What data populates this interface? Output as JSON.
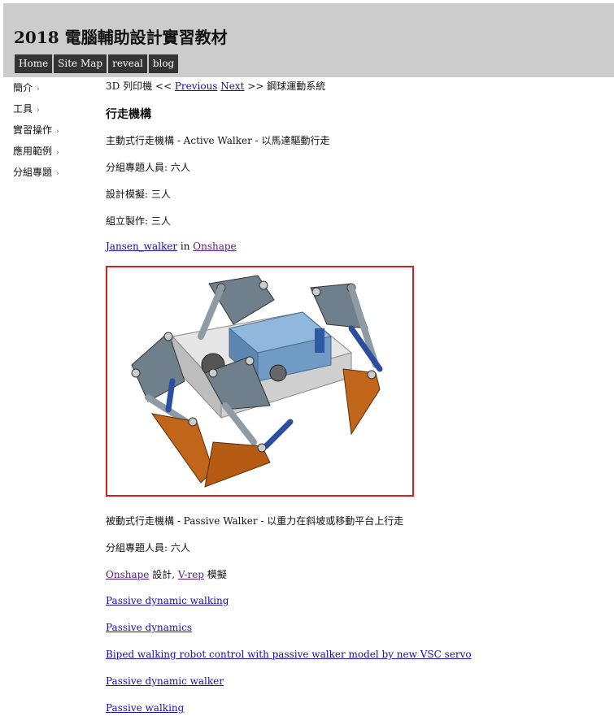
{
  "site": {
    "title": "2018 電腦輔助設計實習教材"
  },
  "topnav": [
    "Home",
    "Site Map",
    "reveal",
    "blog"
  ],
  "sidebar": [
    "簡介",
    "工具",
    "實習操作",
    "應用範例",
    "分組專題"
  ],
  "breadcrumb": {
    "prefix": "3D 列印機 <<",
    "previous": "Previous",
    "next": "Next",
    "suffix": ">> 鋼球運動系統"
  },
  "page": {
    "heading": "行走機構",
    "active_desc": "主動式行走機構 - Active Walker - 以馬達驅動行走",
    "members_1": "分組專題人員: 六人",
    "design": "設計模擬: 三人",
    "assembly": "組立製作: 三人",
    "jansen_link": "Jansen_walker",
    "in_text": " in ",
    "onshape_link": "Onshape",
    "passive_desc": "被動式行走機構 - Passive Walker - 以重力在斜坡或移動平台上行走",
    "members_2": "分組專題人員: 六人",
    "onshape_link_2": "Onshape",
    "design_text": " 設計, ",
    "vrep_link": "V-rep",
    "sim_text": " 模擬"
  },
  "links": [
    "Passive dynamic walking",
    "Passive dynamics",
    "Biped walking robot control with passive walker model by new VSC servo",
    "Passive dynamic walker",
    "Passive walking"
  ],
  "figure": {
    "border_color": "#d81e1e"
  }
}
